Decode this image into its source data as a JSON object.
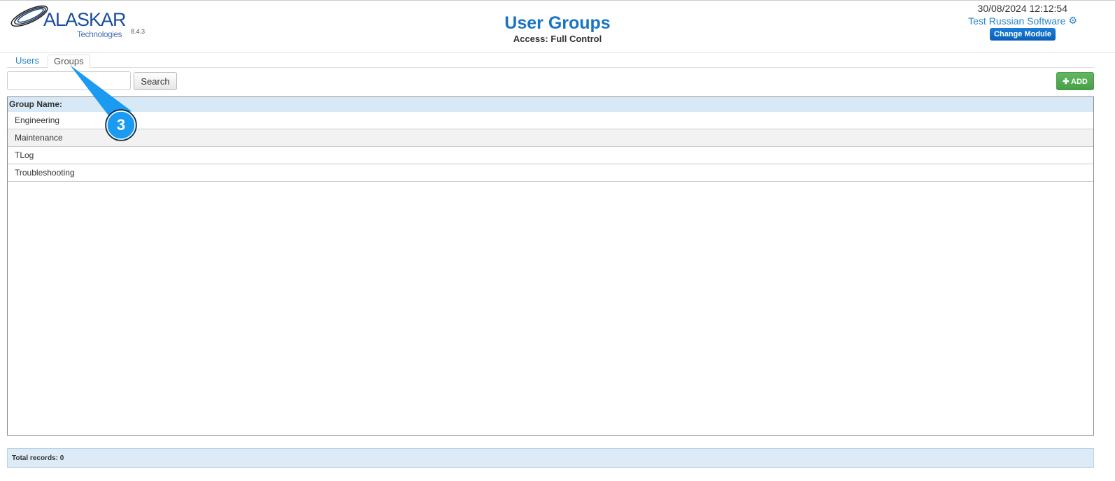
{
  "header": {
    "logo_text": "ALASKAR",
    "logo_sub": "Technologies",
    "version": "8.4.3",
    "title": "User Groups",
    "access": "Access: Full Control",
    "datetime": "30/08/2024 12:12:54",
    "company": "Test Russian Software",
    "change_module": "Change Module"
  },
  "tabs": [
    {
      "label": "Users"
    },
    {
      "label": "Groups",
      "active": true
    }
  ],
  "toolbar": {
    "search_value": "",
    "search_label": "Search",
    "add_label": "ADD"
  },
  "grid": {
    "header": "Group Name:",
    "rows": [
      "Engineering",
      "Maintenance",
      "TLog",
      "Troubleshooting"
    ]
  },
  "footer": {
    "total": "Total records: 0"
  },
  "annotation": {
    "number": "3",
    "color": "#1a9af0"
  }
}
